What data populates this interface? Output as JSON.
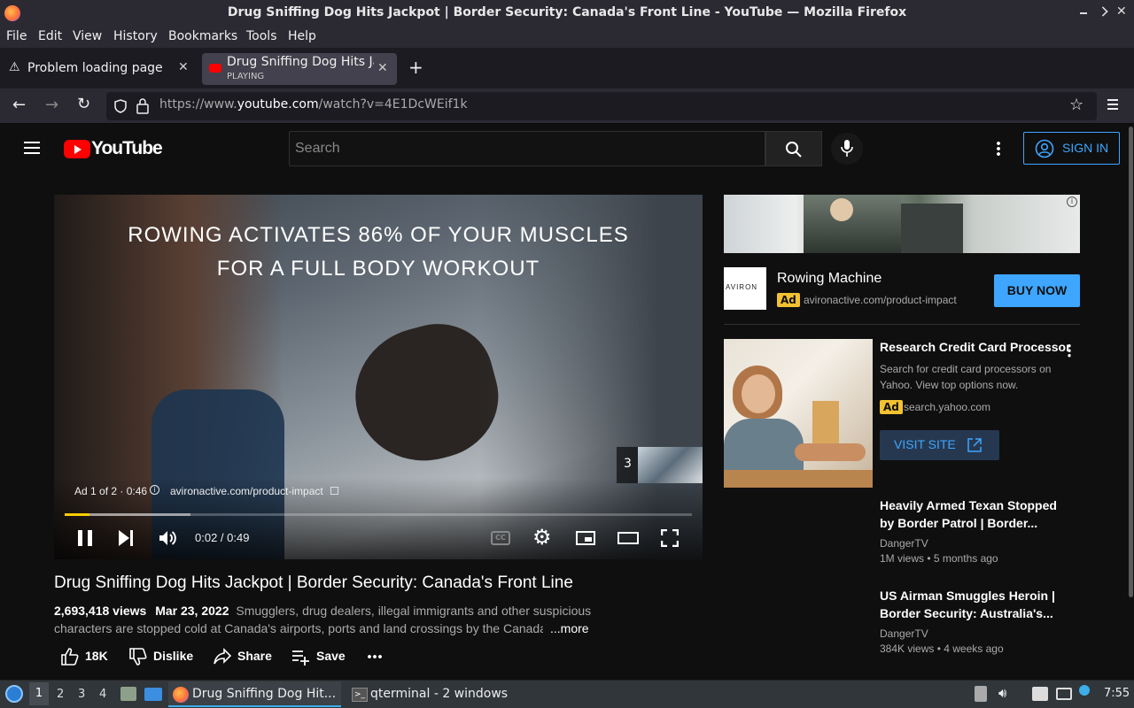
{
  "window_title": "Drug Sniffing Dog Hits Jackpot | Border Security: Canada's Front Line - YouTube — Mozilla Firefox",
  "menu": [
    "File",
    "Edit",
    "View",
    "History",
    "Bookmarks",
    "Tools",
    "Help"
  ],
  "tabs": [
    {
      "label": "Problem loading page"
    },
    {
      "label": "Drug Sniffing Dog Hits Ja",
      "sub": "PLAYING"
    }
  ],
  "url": {
    "prefix": "https://www.",
    "domain": "youtube.com",
    "path": "/watch?v=4E1DcWEif1k"
  },
  "yt": {
    "logo_text": "YouTube",
    "search_placeholder": "Search",
    "sign_in": "SIGN IN"
  },
  "player": {
    "overlay_line1": "ROWING ACTIVATES 86% OF YOUR MUSCLES",
    "overlay_line2": "FOR A FULL BODY WORKOUT",
    "ad_info": "Ad 1 of 2 · 0:46",
    "ad_link": "avironactive.com/product-impact",
    "skip_count": "3",
    "time": "0:02 / 0:49",
    "progress": 0.04,
    "buffer": 0.2
  },
  "video": {
    "title": "Drug Sniffing Dog Hits Jackpot | Border Security: Canada's Front Line",
    "views": "2,693,418 views",
    "date": "Mar 23, 2022",
    "desc1": "Smugglers, drug dealers, illegal immigrants and other suspicious",
    "desc2": "characters are stopped cold at Canada's airports, ports and land crossings by the Canada",
    "more": "...more",
    "likes": "18K",
    "dislike": "Dislike",
    "share": "Share",
    "save": "Save"
  },
  "ad1": {
    "brand_logo": "AVIRON",
    "title": "Rowing Machine",
    "badge": "Ad",
    "domain": "avironactive.com/product-impact",
    "cta": "BUY NOW"
  },
  "ad2": {
    "title": "Research Credit Card Processor",
    "desc": "Search for credit card processors on Yahoo. View top options now.",
    "badge": "Ad",
    "domain": "search.yahoo.com",
    "cta": "VISIT SITE"
  },
  "related": [
    {
      "title": "Heavily Armed Texan Stopped by Border Patrol | Border...",
      "channel": "DangerTV",
      "meta": "1M views • 5 months ago"
    },
    {
      "title": "US Airman Smuggles Heroin | Border Security: Australia's...",
      "channel": "DangerTV",
      "meta": "384K views • 4 weeks ago"
    }
  ],
  "taskbar": {
    "workspaces": [
      "1",
      "2",
      "3",
      "4"
    ],
    "apps": [
      {
        "label": "Drug Sniffing Dog Hit..."
      },
      {
        "label": "qterminal - 2 windows"
      }
    ],
    "clock": "7:55"
  },
  "colors": {
    "accent": "#3ea6ff",
    "yt_red": "#ff0000",
    "ad_badge": "#f2c230",
    "progress": "#ffcc00"
  }
}
